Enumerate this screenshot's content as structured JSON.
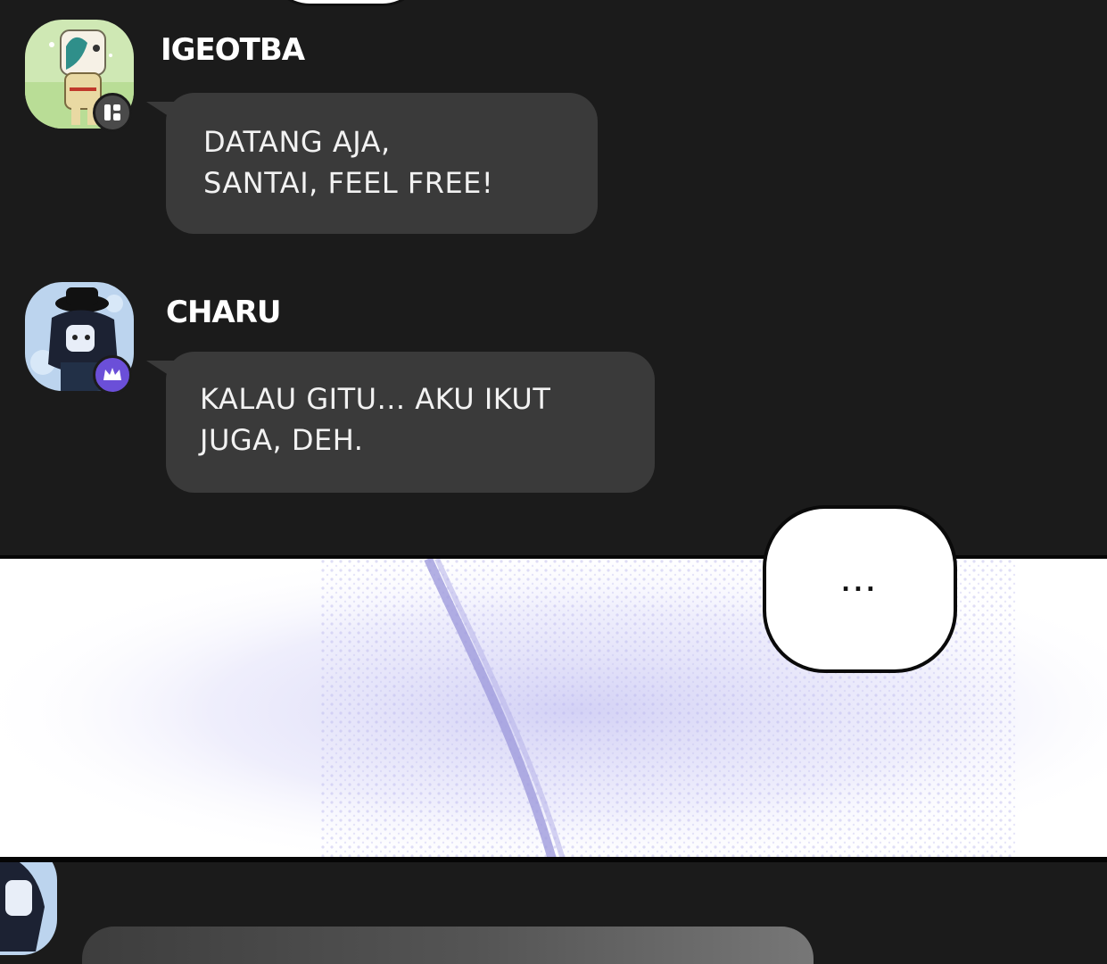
{
  "messages": [
    {
      "sender": "IGEOTBA",
      "lines": [
        "DATANG AJA,",
        "SANTAI, FEEL FREE!"
      ],
      "badge_icon": "grid-badge-icon",
      "badge_color": "#4a4a4a"
    },
    {
      "sender": "CHARU",
      "lines": [
        "KALAU GITU... AKU IKUT",
        "JUGA, DEH."
      ],
      "badge_icon": "crown-badge-icon",
      "badge_color": "#6b4fd8"
    }
  ],
  "speech_bubble": {
    "text": "..."
  },
  "colors": {
    "background": "#1b1b1b",
    "bubble": "#3a3a3a",
    "texture": "#a9a6e8"
  }
}
